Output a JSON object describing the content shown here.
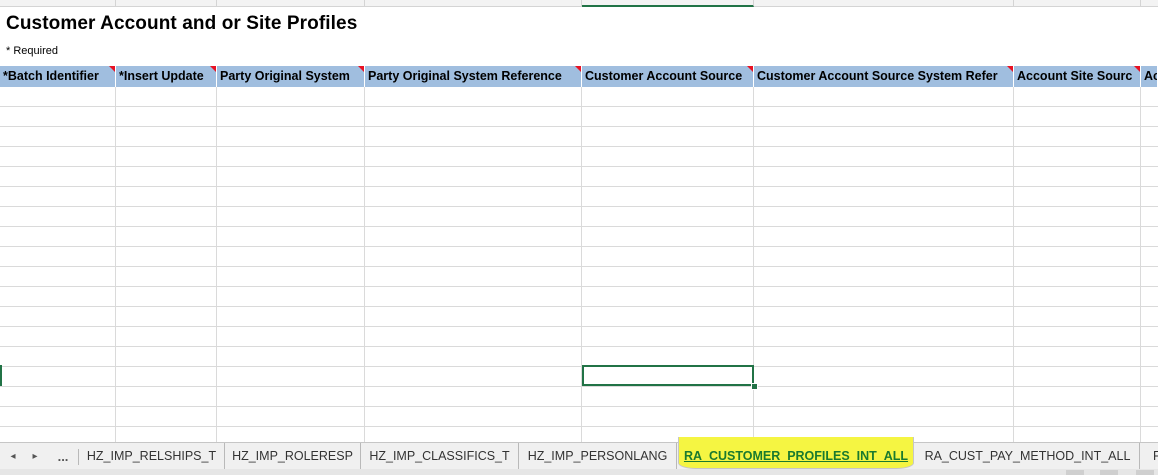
{
  "sheet": {
    "title": "Customer Account and or Site Profiles",
    "required_note": "* Required",
    "columns": [
      {
        "label": "*Batch Identifier",
        "required_marker": true
      },
      {
        "label": "*Insert Update",
        "required_marker": true
      },
      {
        "label": "Party Original System",
        "required_marker": true
      },
      {
        "label": "Party Original System Reference",
        "required_marker": true
      },
      {
        "label": "Customer Account Source",
        "required_marker": true
      },
      {
        "label": "Customer Account Source System Refer",
        "required_marker": true
      },
      {
        "label": "Account Site Sourc",
        "required_marker": true
      },
      {
        "label": "Ac",
        "required_marker": false
      }
    ]
  },
  "tabs": {
    "nav_prev": "◂",
    "nav_next": "▸",
    "more": "...",
    "items": [
      "HZ_IMP_RELSHIPS_T",
      "HZ_IMP_ROLERESP",
      "HZ_IMP_CLASSIFICS_T",
      "HZ_IMP_PERSONLANG",
      "RA_CUSTOMER_PROFILES_INT_ALL",
      "RA_CUST_PAY_METHOD_INT_ALL",
      "F"
    ],
    "active_index": 4
  },
  "colors": {
    "header_fill": "#a0bedf",
    "active_tab_highlight": "#f5f542",
    "active_tab_text": "#1a7a2e",
    "selection_border": "#217346",
    "required_marker": "#e81123"
  }
}
